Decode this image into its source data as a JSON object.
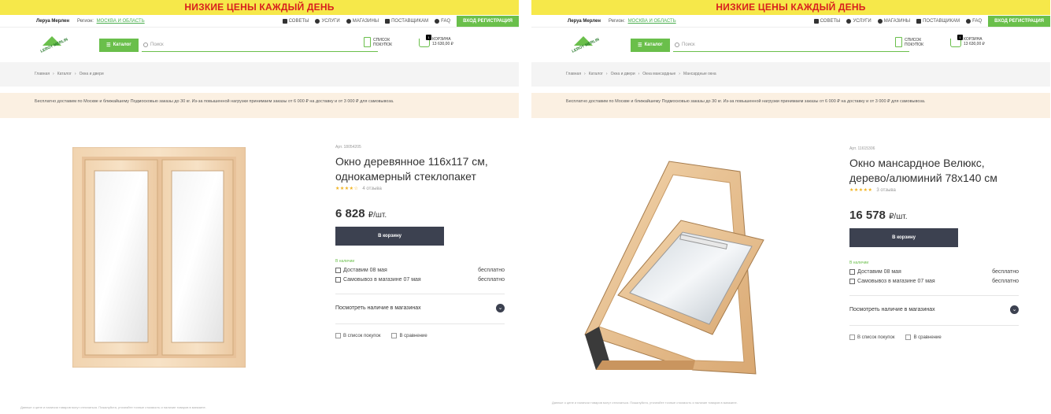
{
  "panels": [
    {
      "promo": "НИЗКИЕ ЦЕНЫ КАЖДЫЙ ДЕНЬ",
      "topbar": {
        "brand": "Леруа Мерлен",
        "region_label": "Регион:",
        "region_value": "МОСКВА И ОБЛАСТЬ",
        "links": [
          "СОВЕТЫ",
          "УСЛУГИ",
          "МАГАЗИНЫ",
          "ПОСТАВЩИКАМ",
          "FAQ"
        ],
        "login": "ВХОД   РЕГИСТРАЦИЯ"
      },
      "header": {
        "logo_text": "LEROY MERLIN",
        "catalog": "Каталог",
        "search_placeholder": "Поиск",
        "shopping_list": "СПИСОК ПОКУПОК",
        "cart_label": "КОРЗИНА",
        "cart_sum": "13 630,00 ₽",
        "cart_count": "1"
      },
      "breadcrumbs": [
        "Главная",
        "Каталог",
        "Окна и двери"
      ],
      "delivery": "Бесплатно доставим по Москве и ближайшему Подмосковью заказы до 30 кг. Из-за повышенной нагрузки принимаем заказы от 6 000 ₽ на доставку и от 3 000 ₽ для самовывоза.",
      "product": {
        "article": "Арт. 18054205",
        "title": "Окно деревянное 116х117 см, однокамерный стеклопакет",
        "stars": "★★★★☆",
        "reviews": "4 отзыва",
        "price": "6 828",
        "price_unit": "₽/шт.",
        "cart_button": "В корзину",
        "in_stock": "В наличии",
        "delivery_row": "Доставим 08 мая",
        "delivery_price": "бесплатно",
        "pickup_row": "Самовывоз в магазине 07 мая",
        "pickup_price": "бесплатно",
        "availability": "Посмотреть наличие в магазинах",
        "to_list": "В список покупок",
        "to_compare": "В сравнение"
      },
      "footnote": "Данные о цене и наличии товаров могут отличаться. Пожалуйста, уточняйте точные стоимость и наличие товаров в магазине."
    },
    {
      "promo": "НИЗКИЕ ЦЕНЫ КАЖДЫЙ ДЕНЬ",
      "topbar": {
        "brand": "Леруа Мерлен",
        "region_label": "Регион:",
        "region_value": "МОСКВА И ОБЛАСТЬ",
        "links": [
          "СОВЕТЫ",
          "УСЛУГИ",
          "МАГАЗИНЫ",
          "ПОСТАВЩИКАМ",
          "FAQ"
        ],
        "login": "ВХОД   РЕГИСТРАЦИЯ"
      },
      "header": {
        "logo_text": "LEROY MERLIN",
        "catalog": "Каталог",
        "search_placeholder": "Поиск",
        "shopping_list": "СПИСОК ПОКУПОК",
        "cart_label": "КОРЗИНА",
        "cart_sum": "13 630,00 ₽",
        "cart_count": "1"
      },
      "breadcrumbs": [
        "Главная",
        "Каталог",
        "Окна и двери",
        "Окна мансардные",
        "Мансардные окна"
      ],
      "delivery": "Бесплатно доставим по Москве и ближайшему Подмосковью заказы до 30 кг. Из-за повышенной нагрузки принимаем заказы от 6 000 ₽ на доставку и от 3 000 ₽ для самовывоза.",
      "product": {
        "article": "Арт. 11615306",
        "title": "Окно мансардное Велюкс, дерево/алюминий 78х140 см",
        "stars": "★★★★★",
        "reviews": "3 отзыва",
        "price": "16 578",
        "price_unit": "₽/шт.",
        "cart_button": "В корзину",
        "in_stock": "В наличии",
        "delivery_row": "Доставим 08 мая",
        "delivery_price": "бесплатно",
        "pickup_row": "Самовывоз в магазине 07 мая",
        "pickup_price": "бесплатно",
        "availability": "Посмотреть наличие в магазинах",
        "to_list": "В список покупок",
        "to_compare": "В сравнение"
      },
      "footnote": "Данные о цене и наличии товаров могут отличаться. Пожалуйста, уточняйте точные стоимость и наличие товаров в магазине."
    }
  ],
  "colors": {
    "promo_bg": "#f6e84a",
    "promo_text": "#d81e1e",
    "brand_green": "#6abf4b",
    "button_dark": "#3c4150",
    "star": "#f1b21d"
  }
}
